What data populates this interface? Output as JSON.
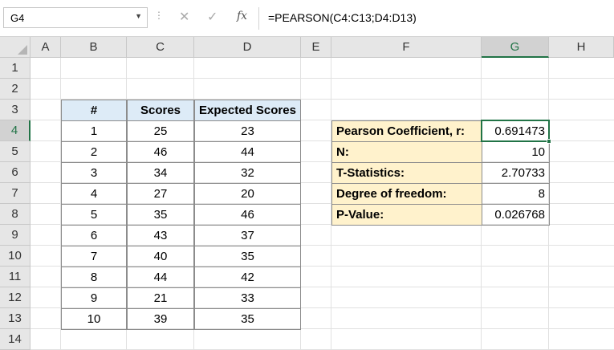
{
  "formula_bar": {
    "name_box": "G4",
    "name_box_dropdown": "▼",
    "dots": "⋮",
    "cancel_glyph": "✕",
    "enter_glyph": "✓",
    "fx_label": "fx",
    "formula": "=PEARSON(C4:C13;D4:D13)"
  },
  "columns": [
    "A",
    "B",
    "C",
    "D",
    "E",
    "F",
    "G",
    "H"
  ],
  "selected_column": "G",
  "rows": [
    "1",
    "2",
    "3",
    "4",
    "5",
    "6",
    "7",
    "8",
    "9",
    "10",
    "11",
    "12",
    "13",
    "14"
  ],
  "selected_row": "4",
  "table": {
    "headers": [
      "#",
      "Scores",
      "Expected Scores"
    ],
    "rows": [
      [
        "1",
        "25",
        "23"
      ],
      [
        "2",
        "46",
        "44"
      ],
      [
        "3",
        "34",
        "32"
      ],
      [
        "4",
        "27",
        "20"
      ],
      [
        "5",
        "35",
        "46"
      ],
      [
        "6",
        "43",
        "37"
      ],
      [
        "7",
        "40",
        "35"
      ],
      [
        "8",
        "44",
        "42"
      ],
      [
        "9",
        "21",
        "33"
      ],
      [
        "10",
        "39",
        "35"
      ]
    ]
  },
  "stats": [
    {
      "label": "Pearson Coefficient, r:",
      "value": "0.691473"
    },
    {
      "label": "N:",
      "value": "10"
    },
    {
      "label": "T-Statistics:",
      "value": "2.70733"
    },
    {
      "label": "Degree of freedom:",
      "value": "8"
    },
    {
      "label": "P-Value:",
      "value": "0.026768"
    }
  ],
  "colors": {
    "accent": "#217346",
    "table_header_fill": "#ddebf7",
    "stats_label_fill": "#fff2cc"
  }
}
